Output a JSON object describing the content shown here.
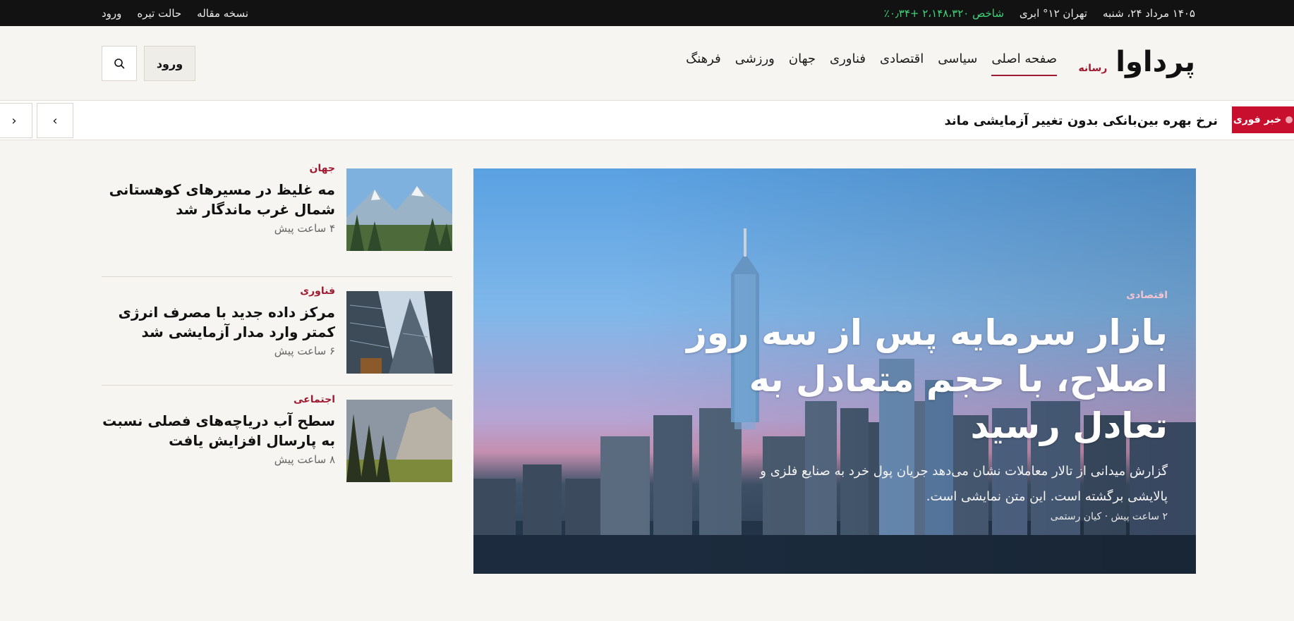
{
  "topbar": {
    "date": "۱۴۰۵ مرداد ۲۴، شنبه",
    "weather": "تهران ۱۲° ابری",
    "market": "شاخص ۲،۱۴۸،۳۲۰ +۰٫۳۴٪",
    "links": [
      "نسخه مقاله",
      "حالت تیره",
      "ورود"
    ]
  },
  "header": {
    "logo": "پرداوا",
    "logo_sub": "رسانه",
    "nav": [
      "صفحه اصلی",
      "سیاسی",
      "اقتصادی",
      "فناوری",
      "جهان",
      "ورزشی",
      "فرهنگ"
    ],
    "login_label": "ورود"
  },
  "ticker": {
    "badge": "خبر فوری",
    "headline": "نرخ بهره بین‌بانکی بدون تغییر آزمایشی ماند",
    "prev": "‹",
    "next": "›"
  },
  "hero": {
    "category": "اقتصادی",
    "title": "بازار سرمایه پس از سه روز اصلاح، با حجم متعادل به تعادل رسید",
    "lead": "گزارش میدانی از تالار معاملات نشان می‌دهد جریان پول خرد به صنایع فلزی و پالایشی برگشته است. این متن نمایشی است.",
    "meta": "۲ ساعت پیش · کیان رستمی"
  },
  "side": [
    {
      "category": "جهان",
      "title": "مه غلیظ در مسیرهای کوهستانی شمال غرب ماندگار شد",
      "time": "۴ ساعت پیش"
    },
    {
      "category": "فناوری",
      "title": "مرکز داده جدید با مصرف انرژی کمتر وارد مدار آزمایشی شد",
      "time": "۶ ساعت پیش"
    },
    {
      "category": "اجتماعی",
      "title": "سطح آب دریاچه‌های فصلی نسبت به پارسال افزایش یافت",
      "time": "۸ ساعت پیش"
    }
  ],
  "colors": {
    "accent": "#a01a32",
    "breaking": "#c8102e",
    "market": "#3ed47a",
    "topbar_bg": "#121212"
  },
  "icons": {
    "search": "search-icon",
    "prev": "chevron-left-icon",
    "next": "chevron-right-icon"
  }
}
